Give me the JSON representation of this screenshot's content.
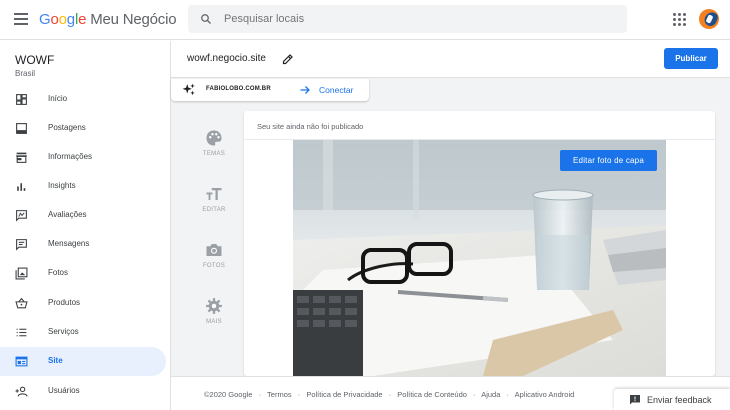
{
  "header": {
    "logo_google": [
      "G",
      "o",
      "o",
      "g",
      "l",
      "e"
    ],
    "logo_product": "Meu Negócio",
    "search_placeholder": "Pesquisar locais"
  },
  "sidebar": {
    "business_name": "WOWF",
    "business_location": "Brasil",
    "items": [
      {
        "label": "Início",
        "icon": "dashboard-icon"
      },
      {
        "label": "Postagens",
        "icon": "posts-icon"
      },
      {
        "label": "Informações",
        "icon": "store-icon"
      },
      {
        "label": "Insights",
        "icon": "bar-chart-icon"
      },
      {
        "label": "Avaliações",
        "icon": "reviews-icon"
      },
      {
        "label": "Mensagens",
        "icon": "message-icon"
      },
      {
        "label": "Fotos",
        "icon": "photos-icon"
      },
      {
        "label": "Produtos",
        "icon": "basket-icon"
      },
      {
        "label": "Serviços",
        "icon": "list-icon"
      },
      {
        "label": "Site",
        "icon": "web-icon",
        "active": true
      },
      {
        "label": "Usuários",
        "icon": "add-user-icon"
      }
    ]
  },
  "main": {
    "site_url": "wowf.negocio.site",
    "publish_label": "Publicar",
    "domain": "FABIOLOBO.COM.BR",
    "connect_label": "Conectar",
    "tools": [
      {
        "label": "TEMAS",
        "icon": "palette-icon"
      },
      {
        "label": "EDITAR",
        "icon": "text-size-icon"
      },
      {
        "label": "FOTOS",
        "icon": "camera-icon"
      },
      {
        "label": "MAIS",
        "icon": "gear-icon"
      }
    ],
    "not_published": "Seu site ainda não foi publicado",
    "cover_button": "Editar foto de capa"
  },
  "footer": {
    "links": [
      "©2020 Google",
      "·",
      "Termos",
      "·",
      "Política de Privacidade",
      "·",
      "Política de Conteúdo",
      "·",
      "Ajuda",
      "·",
      "Aplicativo Android"
    ],
    "feedback": "Enviar feedback"
  },
  "colors": {
    "accent": "#1a73e8",
    "active_bg": "#e8f0fe"
  }
}
